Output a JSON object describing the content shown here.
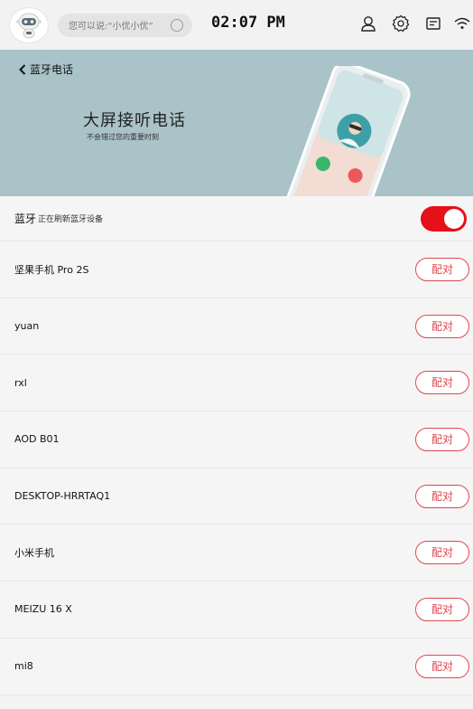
{
  "status_bar": {
    "search_placeholder": "您可以说:“小优小优”",
    "time": "02:07 PM"
  },
  "banner": {
    "back_label": "蓝牙电话",
    "title": "大屏接听电话",
    "subtitle": "不会错过您的重要时刻"
  },
  "bluetooth": {
    "label": "蓝牙",
    "status": "正在刷新蓝牙设备",
    "enabled": true
  },
  "devices": [
    {
      "name": "坚果手机 Pro 2S",
      "action": "配对"
    },
    {
      "name": "yuan",
      "action": "配对"
    },
    {
      "name": "rxl",
      "action": "配对"
    },
    {
      "name": "AOD B01",
      "action": "配对"
    },
    {
      "name": "DESKTOP-HRRTAQ1",
      "action": "配对"
    },
    {
      "name": "小米手机",
      "action": "配对"
    },
    {
      "name": "MEIZU 16 X",
      "action": "配对"
    },
    {
      "name": "mi8",
      "action": "配对"
    }
  ],
  "colors": {
    "accent": "#e5101a",
    "banner_bg": "#a9c3c9"
  }
}
